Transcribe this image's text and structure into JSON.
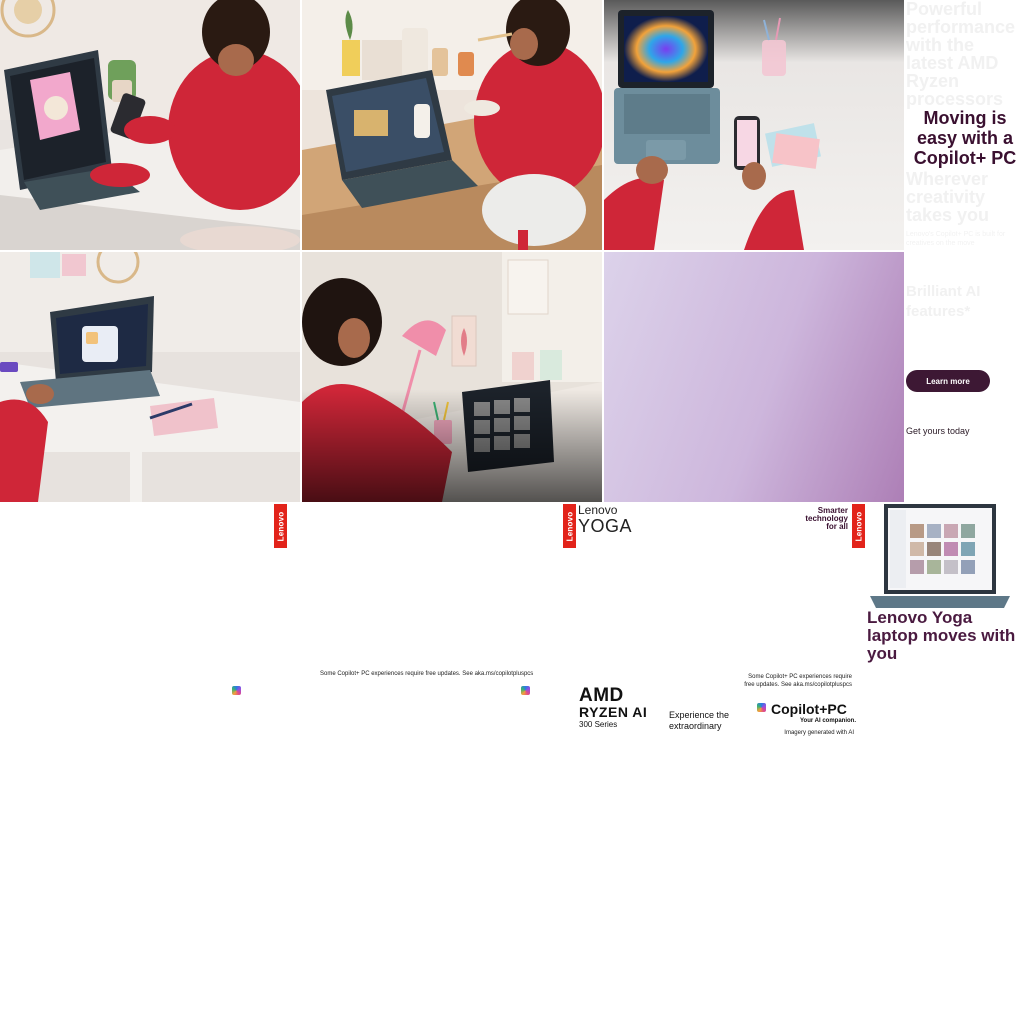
{
  "copy": {
    "ghost_headline": "Powerful performance with the latest AMD Ryzen processors",
    "headline": "Moving is easy with a Copilot+ PC",
    "ghost_subhead": "Wherever creativity takes you",
    "ghost_small": "Lenovo's Copilot+ PC is built for creatives on the move",
    "ghost_features": "Brilliant AI features*",
    "learn_more": "Learn more",
    "get_yours": "Get yours today"
  },
  "banner": {
    "lenovo_tag": "Lenovo",
    "yoga_lenovo": "Lenovo",
    "yoga_word": "YOGA",
    "smarter_line1": "Smarter",
    "smarter_line2": "technology",
    "smarter_line3": "for all",
    "fineprint_1": "Some Copilot+ PC experiences require free updates. See aka.ms/copilotpluspcs",
    "fineprint_2a": "Some Copilot+ PC experiences require",
    "fineprint_2b": "free updates. See aka.ms/copilotpluspcs",
    "amd_logo": "AMD",
    "ryzen": "RYZEN AI",
    "series": "300 Series",
    "experience_1": "Experience the",
    "experience_2": "extraordinary",
    "copilot": "Copilot+PC",
    "companion": "Your AI companion.",
    "imagery": "Imagery generated with AI",
    "yoga_headline": "Lenovo Yoga laptop moves with you"
  },
  "colors": {
    "brand_red": "#e2231a",
    "button_plum": "#3d1834",
    "headline_plum": "#3a1030"
  }
}
